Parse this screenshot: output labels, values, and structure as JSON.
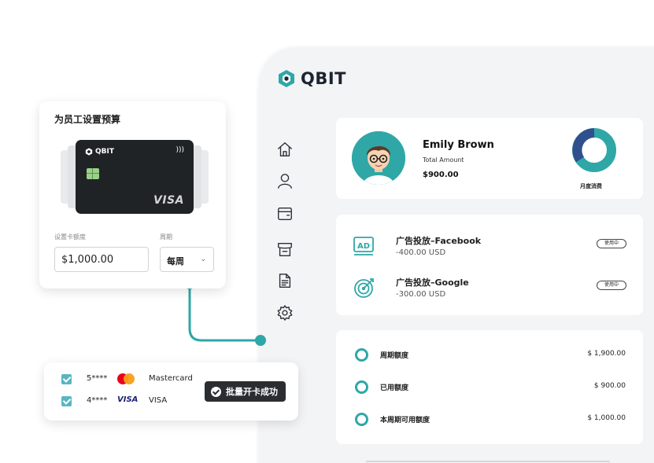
{
  "colors": {
    "accent": "#2fa7a7",
    "dark": "#1f2326",
    "panel_bg": "#f3f4f6"
  },
  "app": {
    "brand": "QBIT",
    "nav": [
      {
        "icon": "home-icon"
      },
      {
        "icon": "user-icon"
      },
      {
        "icon": "wallet-icon"
      },
      {
        "icon": "store-icon"
      },
      {
        "icon": "document-icon"
      },
      {
        "icon": "settings-icon"
      }
    ],
    "profile": {
      "name": "Emily Brown",
      "sub_label": "Total Amount",
      "amount": "$900.00",
      "donut_label": "月度消费"
    },
    "ads": [
      {
        "icon": "ad-icon",
        "title": "广告投放–Facebook",
        "amount": "-400.00 USD",
        "status": "使用中"
      },
      {
        "icon": "target-icon",
        "title": "广告投放–Google",
        "amount": "-300.00 USD",
        "status": "使用中"
      }
    ],
    "limits": [
      {
        "label": "周期额度",
        "value": "$ 1,900.00"
      },
      {
        "label": "已用额度",
        "value": "$ 900.00"
      },
      {
        "label": "本周期可用额度",
        "value": "$ 1,000.00"
      }
    ]
  },
  "budget": {
    "title": "为员工设置预算",
    "card_brand": "QBIT",
    "card_network": "VISA",
    "limit_label": "设置卡额度",
    "limit_value": "$1,000.00",
    "period_label": "周期",
    "period_value": "每周"
  },
  "batch": {
    "cards": [
      {
        "number": "5****",
        "brand": "Mastercard",
        "checked": true
      },
      {
        "number": "4****",
        "brand": "VISA",
        "checked": true
      }
    ],
    "visa_logo": "VISA",
    "toast": "批量开卡成功"
  }
}
